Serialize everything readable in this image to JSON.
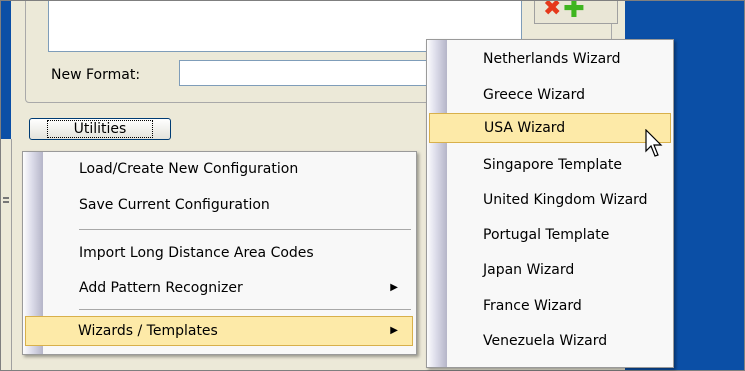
{
  "form": {
    "new_format_label": "New Format:",
    "new_format_value": "",
    "utilities_button": "Utilities"
  },
  "icons": {
    "delete": "red-x-icon",
    "add": "green-plus-icon"
  },
  "context_menu": {
    "items": [
      {
        "label": "Load/Create New Configuration"
      },
      {
        "label": "Save Current Configuration"
      },
      {
        "label": "Import Long Distance Area Codes"
      },
      {
        "label": "Add Pattern Recognizer",
        "submenu": true
      },
      {
        "label": "Wizards / Templates",
        "submenu": true,
        "highlighted": true
      }
    ]
  },
  "submenu": {
    "items": [
      {
        "label": "Netherlands Wizard"
      },
      {
        "label": "Greece Wizard"
      },
      {
        "label": "USA Wizard",
        "highlighted": true
      },
      {
        "label": "Singapore Template"
      },
      {
        "label": "United Kingdom Wizard"
      },
      {
        "label": "Portugal Template"
      },
      {
        "label": "Japan Wizard"
      },
      {
        "label": "France Wizard"
      },
      {
        "label": "Venezuela Wizard"
      }
    ]
  },
  "colors": {
    "highlight": "#fdeaa8",
    "highlight_border": "#d8b04b",
    "desktop": "#0b4fa6"
  }
}
